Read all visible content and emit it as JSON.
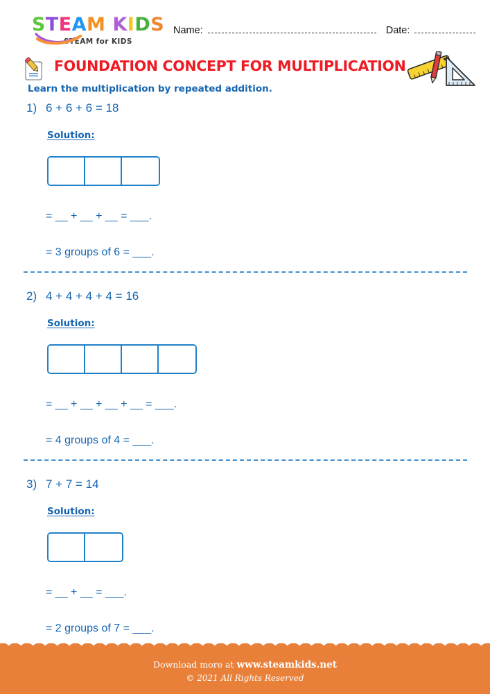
{
  "brand": {
    "logo_letters": [
      {
        "char": "S",
        "color": "#5ec63c"
      },
      {
        "char": "T",
        "color": "#8b4ddb"
      },
      {
        "char": "E",
        "color": "#f0357f"
      },
      {
        "char": "A",
        "color": "#2196f3"
      },
      {
        "char": "M",
        "color": "#f59120"
      },
      {
        "char": " ",
        "color": "#ffffff"
      },
      {
        "char": "K",
        "color": "#b05fd6"
      },
      {
        "char": "I",
        "color": "#f5c518"
      },
      {
        "char": "D",
        "color": "#4caf3f"
      },
      {
        "char": "S",
        "color": "#f0872f"
      }
    ],
    "tagline": "STEAM for KIDS"
  },
  "header": {
    "name_label": "Name:",
    "date_label": "Date:"
  },
  "title": {
    "text": "FOUNDATION CONCEPT FOR MULTIPLICATION",
    "color": "#ed1c24",
    "left_icon": "notepad-pencil-icon",
    "right_icon": "ruler-triangle-icon"
  },
  "instruction": "Learn the multiplication by repeated addition.",
  "solution_label": "Solution:",
  "problems": [
    {
      "number": "1)",
      "equation": "6 + 6 + 6 = 18",
      "boxes": 3,
      "answer_line_1": "= __ + __ + __ = ___.",
      "answer_line_2": "= 3 groups of 6 = ___."
    },
    {
      "number": "2)",
      "equation": "4 + 4 + 4 + 4 = 16",
      "boxes": 4,
      "answer_line_1": "= __ + __ + __ + __ = ___.",
      "answer_line_2": "= 4 groups of 4 = ___."
    },
    {
      "number": "3)",
      "equation": "7 + 7 = 14",
      "boxes": 2,
      "answer_line_1": "= __ + __ = ___.",
      "answer_line_2": "= 2 groups of 7 = ___."
    }
  ],
  "footer": {
    "download_prefix": "Download more at ",
    "website": "www.steamkids.net",
    "copyright": "© 2021 All Rights Reserved",
    "background": "#e8803a"
  },
  "theme": {
    "accent_blue": "#1566b2",
    "box_border": "#2080c8",
    "divider": "#3f8fd0"
  }
}
